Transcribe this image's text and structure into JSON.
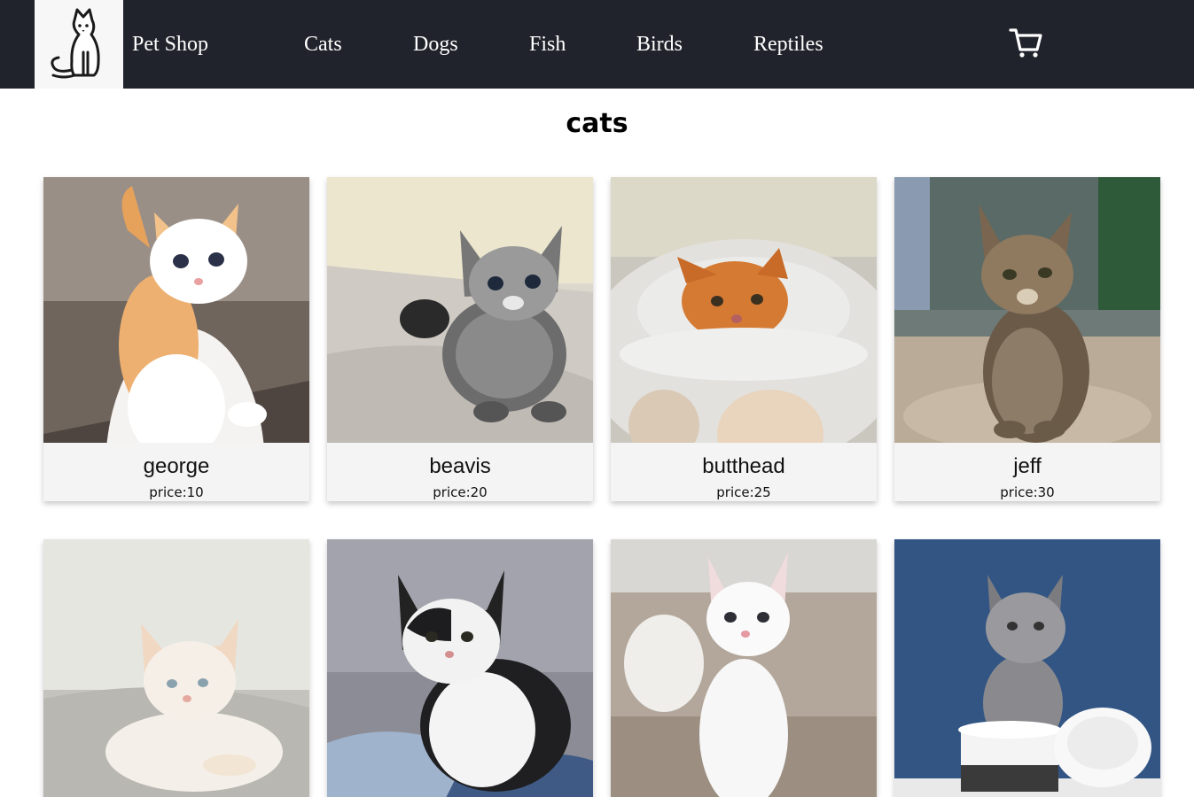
{
  "header": {
    "brand": "Pet Shop",
    "nav": [
      "Cats",
      "Dogs",
      "Fish",
      "Birds",
      "Reptiles"
    ],
    "logo_icon": "cat-logo-icon",
    "cart_icon": "shopping-cart-icon",
    "background": "#20232b"
  },
  "page": {
    "title": "cats"
  },
  "products": [
    {
      "name": "george",
      "price": "price:10"
    },
    {
      "name": "beavis",
      "price": "price:20"
    },
    {
      "name": "butthead",
      "price": "price:25"
    },
    {
      "name": "jeff",
      "price": "price:30"
    },
    {
      "name": "",
      "price": ""
    },
    {
      "name": "",
      "price": ""
    },
    {
      "name": "",
      "price": ""
    },
    {
      "name": "",
      "price": ""
    }
  ]
}
